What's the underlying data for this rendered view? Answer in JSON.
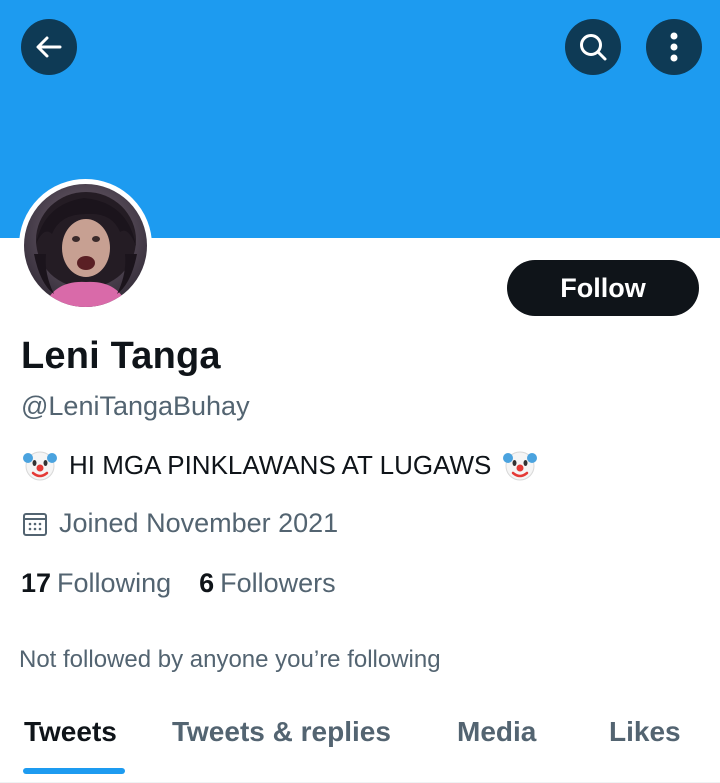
{
  "header": {
    "back_icon": "arrow-left-icon",
    "search_icon": "search-icon",
    "more_icon": "more-vertical-icon",
    "banner_color": "#1d9bf0"
  },
  "profile": {
    "display_name": "Leni Tanga",
    "handle": "@LeniTangaBuhay",
    "bio_text": "HI MGA PINKLAWANS AT LUGAWS",
    "bio_emoji": "clown-face-emoji",
    "joined": "Joined November 2021",
    "joined_icon": "calendar-icon",
    "following_count": "17",
    "following_label": "Following",
    "followers_count": "6",
    "followers_label": "Followers",
    "not_followed_text": "Not followed by anyone you’re following"
  },
  "actions": {
    "follow_label": "Follow"
  },
  "tabs": [
    {
      "label": "Tweets",
      "active": true
    },
    {
      "label": "Tweets & replies",
      "active": false
    },
    {
      "label": "Media",
      "active": false
    },
    {
      "label": "Likes",
      "active": false
    }
  ],
  "colors": {
    "accent": "#1d9bf0",
    "text": "#0f1419",
    "secondary": "#536471"
  }
}
